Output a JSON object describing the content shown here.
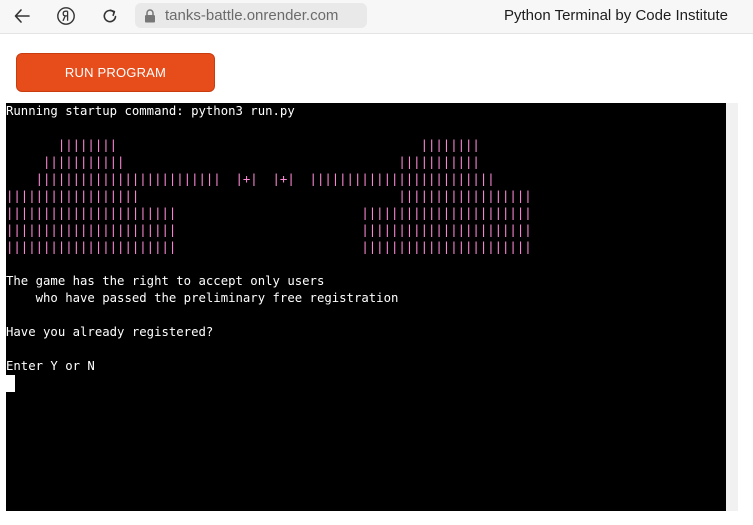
{
  "browser": {
    "url": "tanks-battle.onrender.com",
    "page_title": "Python Terminal by Code Institute",
    "icons": [
      "back-arrow-icon",
      "yandex-icon",
      "reload-icon",
      "lock-icon"
    ]
  },
  "toolbar": {
    "run_label": "RUN PROGRAM",
    "run_color": "#e74c1b"
  },
  "terminal": {
    "background": "#000000",
    "text_color": "#ffffff",
    "art_color": "#ff8ad8",
    "startup": "Running startup command: python3 run.py",
    "art": [
      "       ||||||||                                         ||||||||",
      "     |||||||||||                                     |||||||||||",
      "    |||||||||||||||||||||||||  |+|  |+|  |||||||||||||||||||||||||",
      "||||||||||||||||||                                   ||||||||||||||||||",
      "|||||||||||||||||||||||                         |||||||||||||||||||||||",
      "|||||||||||||||||||||||                         |||||||||||||||||||||||",
      "|||||||||||||||||||||||                         |||||||||||||||||||||||"
    ],
    "message_line1": "The game has the right to accept only users",
    "message_line2": "    who have passed the preliminary free registration",
    "question": "Have you already registered?",
    "prompt": "Enter Y or N"
  }
}
